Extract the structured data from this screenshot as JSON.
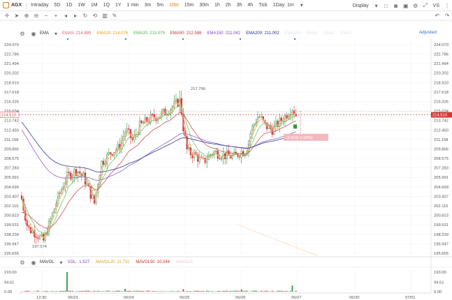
{
  "toolbar": {
    "symbol": "AGX",
    "timeframes": [
      "Intraday",
      "5D",
      "1D",
      "1W",
      "1M",
      "1Q",
      "1Y",
      "1 min",
      "3m",
      "5m",
      "10m",
      "15m",
      "30m",
      "1h",
      "2h",
      "3h",
      "4h",
      "Tick",
      "1Day: 1m"
    ],
    "active_timeframe": "10m",
    "display_label": "Display",
    "vs_label": "VS"
  },
  "indicators": {
    "ema_label": "EMA",
    "items": [
      {
        "name": "EMA5",
        "value": "214.889",
        "color": "#e06070"
      },
      {
        "name": "EMA10",
        "value": "214.076",
        "color": "#e0a020"
      },
      {
        "name": "EMA20",
        "value": "213.079",
        "color": "#50b050"
      },
      {
        "name": "EMA50",
        "value": "212.588",
        "color": "#c03030"
      },
      {
        "name": "EMA150",
        "value": "211.042",
        "color": "#8040c0"
      },
      {
        "name": "EMA200",
        "value": "211.002",
        "color": "#203080"
      }
    ],
    "faded": [
      "EMA250",
      "EMA1",
      "EMA1",
      "EMA1"
    ],
    "adjusted_label": "Adjusted"
  },
  "price_axis": {
    "ticks": [
      "224.070",
      "222.786",
      "221.494",
      "220.202",
      "218.910",
      "217.618",
      "216.326",
      "215.034",
      "213.742",
      "212.450",
      "211.158",
      "209.866",
      "208.575",
      "207.283",
      "205.991",
      "204.699",
      "203.407",
      "202.115",
      "200.823",
      "199.531",
      "198.239",
      "196.947",
      "195.655"
    ],
    "current_price": "214.510",
    "high_label": "217.790",
    "low_label": "197.074",
    "change_label": "-3.216(-1.50%)"
  },
  "time_axis": {
    "labels": [
      "12:30",
      "06/23",
      "06/24",
      "06/25",
      "06/26",
      "06/27",
      "06/30",
      "07/01"
    ]
  },
  "volume": {
    "mavol_label": "MAVOL",
    "vol_label": "VOL:",
    "vol_value": "1.527",
    "mavol20_label": "MAVOL20",
    "mavol20_value": "11.731",
    "mavol50_label": "MAVOL50",
    "mavol50_value": "10.044",
    "mavol_faded": "MAVOL5",
    "axis_ticks": [
      "193.00",
      "94.61",
      "0.00"
    ]
  },
  "colors": {
    "up": "#2a9a3a",
    "down": "#d23a3a",
    "accent": "#e07a10"
  }
}
